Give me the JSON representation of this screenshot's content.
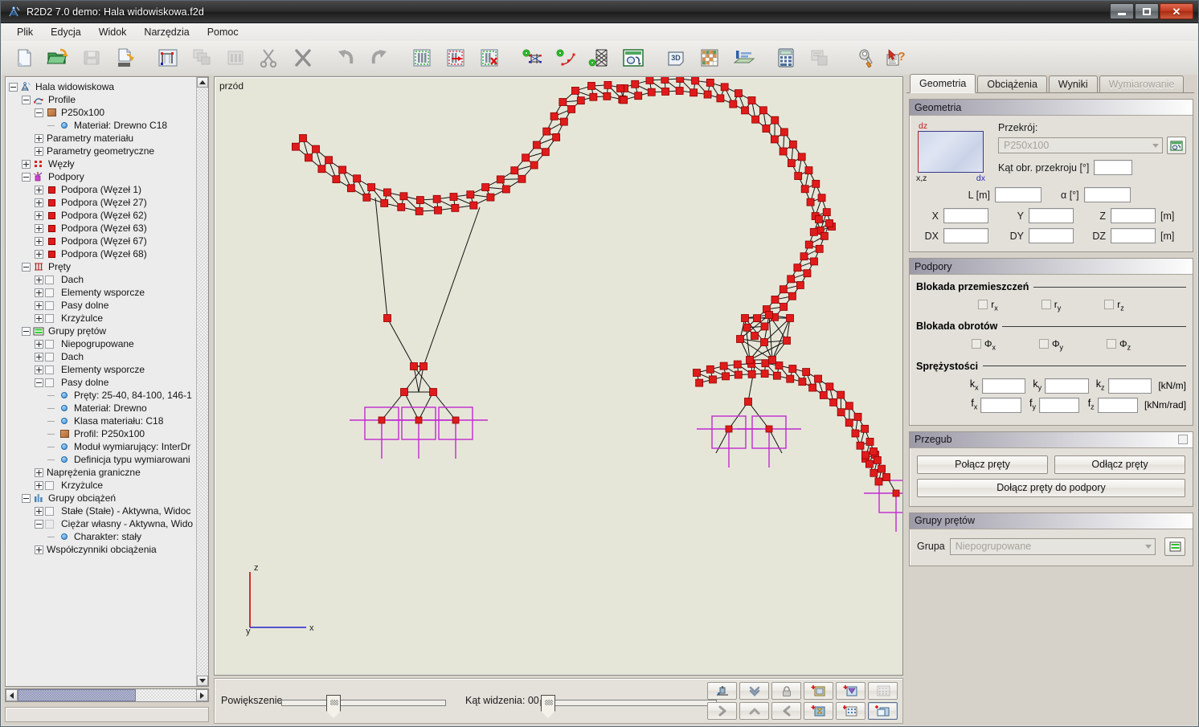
{
  "window": {
    "title": "R2D2 7.0 demo: Hala widowiskowa.f2d",
    "minimize": "—",
    "maximize": "□",
    "close": "✕"
  },
  "menu": {
    "items": [
      {
        "label": "Plik"
      },
      {
        "label": "Edycja"
      },
      {
        "label": "Widok"
      },
      {
        "label": "Narzędzia"
      },
      {
        "label": "Pomoc"
      }
    ]
  },
  "toolbar": {
    "buttons": [
      {
        "icon": "new-file-icon"
      },
      {
        "icon": "open-folder-icon"
      },
      {
        "icon": "save-disk-icon"
      },
      {
        "icon": "export-file-icon"
      },
      {
        "icon": "frame-grid-icon"
      },
      {
        "icon": "copy-layers-icon"
      },
      {
        "icon": "paste-bars-icon"
      },
      {
        "icon": "cut-scissors-icon"
      },
      {
        "icon": "delete-x-icon"
      },
      {
        "icon": "undo-arrow-icon"
      },
      {
        "icon": "redo-arrow-icon"
      },
      {
        "icon": "select-bars-icon"
      },
      {
        "icon": "select-add-icon"
      },
      {
        "icon": "select-remove-icon"
      },
      {
        "icon": "generate-frame-icon"
      },
      {
        "icon": "generate-arc-icon"
      },
      {
        "icon": "generate-truss-icon"
      },
      {
        "icon": "section-editor-icon"
      },
      {
        "icon": "view-3d-icon"
      },
      {
        "icon": "table-grid-icon"
      },
      {
        "icon": "loads-icon"
      },
      {
        "icon": "calculator-icon"
      },
      {
        "icon": "report-icon"
      },
      {
        "icon": "options-wrench-icon"
      },
      {
        "icon": "help-icon"
      }
    ]
  },
  "tree": {
    "nodes": [
      {
        "depth": 0,
        "expander": "minus",
        "icon": "project-icon",
        "label": "Hala widowiskowa"
      },
      {
        "depth": 1,
        "expander": "minus",
        "icon": "profile-icon",
        "label": "Profile"
      },
      {
        "depth": 2,
        "expander": "minus",
        "icon": "brown-square",
        "label": "P250x100"
      },
      {
        "depth": 3,
        "expander": "none",
        "icon": "blue-dot",
        "label": "Materiał: Drewno C18"
      },
      {
        "depth": 2,
        "expander": "plus",
        "icon": "none",
        "label": "Parametry materiału"
      },
      {
        "depth": 2,
        "expander": "plus",
        "icon": "none",
        "label": "Parametry geometryczne"
      },
      {
        "depth": 1,
        "expander": "plus",
        "icon": "nodes-icon",
        "label": "Węzły"
      },
      {
        "depth": 1,
        "expander": "minus",
        "icon": "support-icon",
        "label": "Podpory"
      },
      {
        "depth": 2,
        "expander": "plus",
        "icon": "red-square",
        "label": "Podpora (Węzeł 1)"
      },
      {
        "depth": 2,
        "expander": "plus",
        "icon": "red-square",
        "label": "Podpora (Węzeł 27)"
      },
      {
        "depth": 2,
        "expander": "plus",
        "icon": "red-square",
        "label": "Podpora (Węzeł 62)"
      },
      {
        "depth": 2,
        "expander": "plus",
        "icon": "red-square",
        "label": "Podpora (Węzeł 63)"
      },
      {
        "depth": 2,
        "expander": "plus",
        "icon": "red-square",
        "label": "Podpora (Węzeł 67)"
      },
      {
        "depth": 2,
        "expander": "plus",
        "icon": "red-square",
        "label": "Podpora (Węzeł 68)"
      },
      {
        "depth": 1,
        "expander": "minus",
        "icon": "bars-icon",
        "label": "Pręty"
      },
      {
        "depth": 2,
        "expander": "plus",
        "icon": "checkbox",
        "label": "Dach"
      },
      {
        "depth": 2,
        "expander": "plus",
        "icon": "checkbox",
        "label": "Elementy wsporcze"
      },
      {
        "depth": 2,
        "expander": "plus",
        "icon": "checkbox",
        "label": "Pasy dolne"
      },
      {
        "depth": 2,
        "expander": "plus",
        "icon": "checkbox",
        "label": "Krzyżulce"
      },
      {
        "depth": 1,
        "expander": "minus",
        "icon": "groups-icon",
        "label": "Grupy prętów"
      },
      {
        "depth": 2,
        "expander": "plus",
        "icon": "checkbox",
        "label": "Niepogrupowane"
      },
      {
        "depth": 2,
        "expander": "plus",
        "icon": "checkbox",
        "label": "Dach"
      },
      {
        "depth": 2,
        "expander": "plus",
        "icon": "checkbox",
        "label": "Elementy wsporcze"
      },
      {
        "depth": 2,
        "expander": "minus",
        "icon": "checkbox",
        "label": "Pasy dolne"
      },
      {
        "depth": 3,
        "expander": "none",
        "icon": "blue-dot",
        "label": "Pręty: 25-40, 84-100, 146-1"
      },
      {
        "depth": 3,
        "expander": "none",
        "icon": "blue-dot",
        "label": "Materiał: Drewno"
      },
      {
        "depth": 3,
        "expander": "none",
        "icon": "blue-dot",
        "label": "Klasa materiału: C18"
      },
      {
        "depth": 3,
        "expander": "none",
        "icon": "brown-square",
        "label": "Profil: P250x100"
      },
      {
        "depth": 3,
        "expander": "none",
        "icon": "blue-dot",
        "label": "Moduł wymiarujący: InterDr"
      },
      {
        "depth": 3,
        "expander": "none",
        "icon": "blue-dot",
        "label": "Definicja typu wymiarowani"
      },
      {
        "depth": 2,
        "expander": "plus",
        "icon": "none",
        "label": "Naprężenia graniczne"
      },
      {
        "depth": 2,
        "expander": "plus",
        "icon": "checkbox",
        "label": "Krzyżulce"
      },
      {
        "depth": 1,
        "expander": "minus",
        "icon": "loadgroups-icon",
        "label": "Grupy obciążeń"
      },
      {
        "depth": 2,
        "expander": "plus",
        "icon": "checkbox",
        "label": "Stałe (Stałe) - Aktywna, Widoc"
      },
      {
        "depth": 2,
        "expander": "minus",
        "icon": "checkbox-faded",
        "label": "Ciężar własny - Aktywna, Wido"
      },
      {
        "depth": 3,
        "expander": "none",
        "icon": "blue-dot",
        "label": "Charakter: stały"
      },
      {
        "depth": 2,
        "expander": "plus",
        "icon": "none",
        "label": "Współczynniki obciążenia"
      }
    ]
  },
  "viewport": {
    "view_label": "przód",
    "axes": {
      "z": "z",
      "x": "x",
      "origin": "y"
    }
  },
  "controls": {
    "zoom_label": "Powiększenie",
    "angle_label": "Kąt widzenia: 00",
    "buttons_row1": [
      {
        "icon": "supports-view-icon"
      },
      {
        "icon": "double-chevron-down-icon"
      },
      {
        "icon": "lock-icon"
      }
    ],
    "buttons_row2": [
      {
        "icon": "chevron-right-icon"
      },
      {
        "icon": "chevron-up-icon"
      },
      {
        "icon": "chevron-left-icon"
      }
    ],
    "buttons_right_row1": [
      {
        "icon": "add-node-icon"
      },
      {
        "icon": "add-load-icon"
      },
      {
        "icon": "grid-dots-icon"
      }
    ],
    "buttons_right_row2": [
      {
        "icon": "add-section-icon"
      },
      {
        "icon": "grid-snap-icon"
      },
      {
        "icon": "zoom-window-icon"
      }
    ]
  },
  "rightpanel": {
    "tabs": [
      {
        "label": "Geometria",
        "state": "active"
      },
      {
        "label": "Obciążenia",
        "state": "normal"
      },
      {
        "label": "Wyniki",
        "state": "normal"
      },
      {
        "label": "Wymiarowanie",
        "state": "disabled"
      }
    ],
    "geometry": {
      "title": "Geometria",
      "xsection_dz": "dz",
      "xsection_xz": "x,z",
      "xsection_dx": "dx",
      "section_label": "Przekrój:",
      "section_value": "P250x100",
      "section_button_icon": "section-editor-icon",
      "angle_label": "Kąt obr. przekroju [°]",
      "angle_value": "",
      "length_label": "L [m]",
      "length_value": "",
      "alpha_label": "α [°]",
      "alpha_value": "",
      "x_label": "X",
      "x_value": "",
      "y_label": "Y",
      "y_value": "",
      "z_label": "Z",
      "z_value": "",
      "xyz_unit": "[m]",
      "dx_label": "DX",
      "dx_value": "",
      "dy_label": "DY",
      "dy_value": "",
      "dz_label": "DZ",
      "dz_value": "",
      "d_unit": "[m]"
    },
    "supports": {
      "title": "Podpory",
      "disp_block_label": "Blokada przemieszczeń",
      "disp_checks": [
        {
          "name": "r",
          "sub": "x",
          "checked": false
        },
        {
          "name": "r",
          "sub": "y",
          "checked": false
        },
        {
          "name": "r",
          "sub": "z",
          "checked": false
        }
      ],
      "rot_block_label": "Blokada obrotów",
      "rot_checks": [
        {
          "name": "Φ",
          "sub": "x",
          "checked": false
        },
        {
          "name": "Φ",
          "sub": "y",
          "checked": false
        },
        {
          "name": "Φ",
          "sub": "z",
          "checked": false
        }
      ],
      "spring_label": "Sprężystości",
      "k_row": [
        {
          "name": "k",
          "sub": "x",
          "value": ""
        },
        {
          "name": "k",
          "sub": "y",
          "value": ""
        },
        {
          "name": "k",
          "sub": "z",
          "value": ""
        }
      ],
      "k_unit": "[kN/m]",
      "f_row": [
        {
          "name": "f",
          "sub": "x",
          "value": ""
        },
        {
          "name": "f",
          "sub": "y",
          "value": ""
        },
        {
          "name": "f",
          "sub": "z",
          "value": ""
        }
      ],
      "f_unit": "[kNm/rad]"
    },
    "hinge": {
      "title": "Przegub",
      "connect_label": "Połącz pręty",
      "disconnect_label": "Odłącz pręty",
      "attach_label": "Dołącz pręty do podpory"
    },
    "bargroups": {
      "title": "Grupy prętów",
      "group_label": "Grupa",
      "group_value": "Niepogrupowane",
      "group_button_icon": "groups-icon"
    }
  },
  "colors": {
    "node_red": "#e01b1b",
    "support_magenta": "#c02ad0",
    "canvas_bg": "#e6e6d8",
    "axis_z": "#cc0000",
    "axis_x": "#2222cc",
    "accent_blue": "#2f86d4"
  }
}
